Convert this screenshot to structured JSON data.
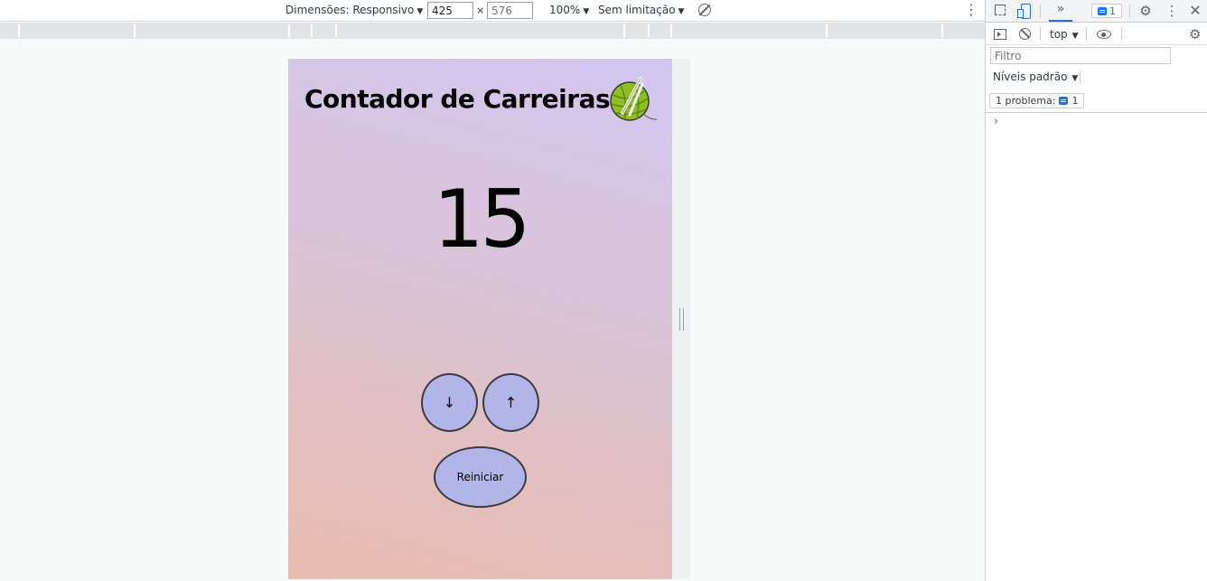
{
  "emulation_toolbar": {
    "dimensions_label": "Dimensões: Responsivo",
    "width_value": "425",
    "times": "×",
    "height_placeholder": "576",
    "zoom": "100%",
    "throttle": "Sem limitação",
    "caret": "▼"
  },
  "app": {
    "title": "Contador de Carreiras",
    "count": "15",
    "decrement_label": "↓",
    "increment_label": "↑",
    "reset_label": "Reiniciar"
  },
  "devtools": {
    "more_tabs": "»",
    "issues_count": "1",
    "context": "top",
    "filter_placeholder": "Filtro",
    "levels": "Níveis padrão",
    "problems_label": "1 problema:",
    "problems_count": "1",
    "prompt": "›"
  },
  "colors": {
    "accent": "#1a73e8",
    "button_fill": "#b3b4e8",
    "yarn_green": "#8fbf1f"
  }
}
